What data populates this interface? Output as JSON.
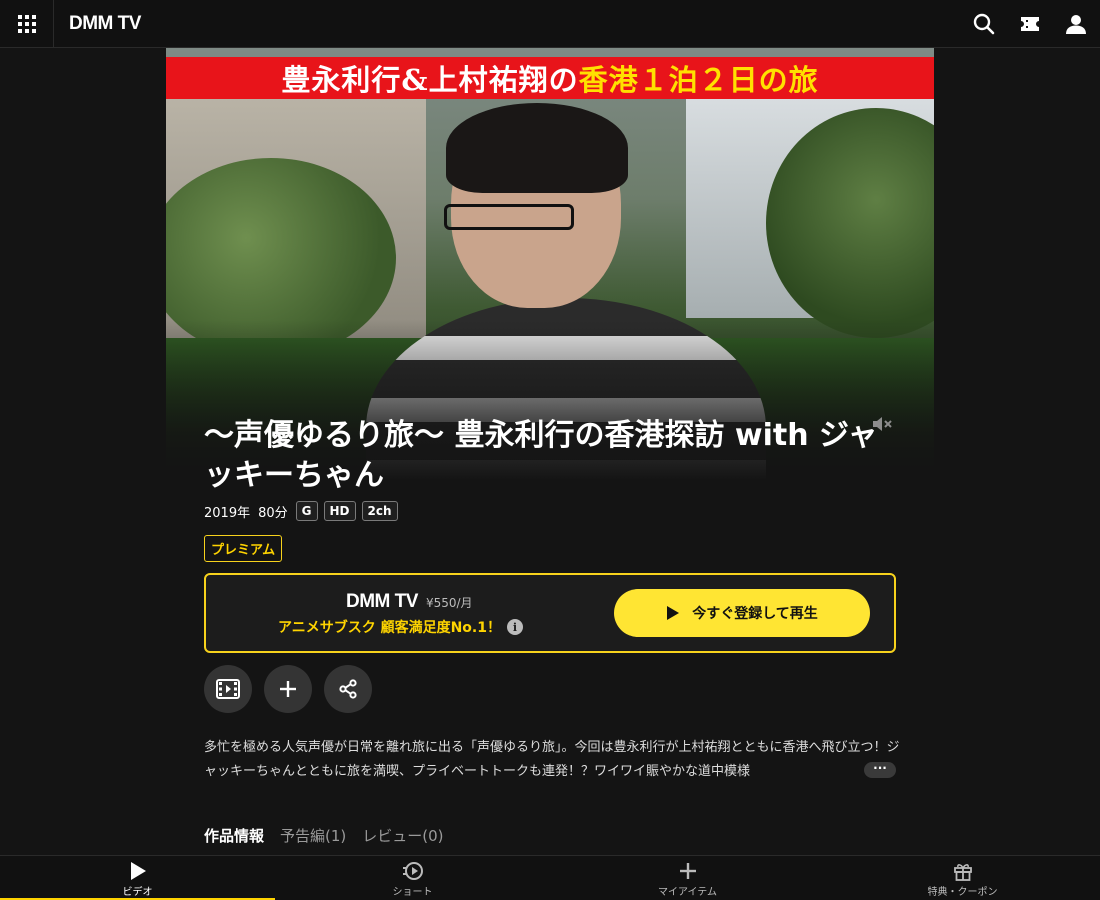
{
  "header": {
    "logo": "DMM TV",
    "icons": [
      "apps-grid-icon",
      "search-icon",
      "ticket-icon",
      "account-icon"
    ]
  },
  "hero": {
    "banner_main": "豊永利行&上村祐翔の",
    "banner_highlight": "香港１泊２日の旅",
    "banner_colors": {
      "background": "#e8141a",
      "text": "#ffffff",
      "highlight": "#ffe100"
    },
    "mute_icon": "speaker-muted-icon"
  },
  "title": "～声優ゆるり旅～ 豊永利行の香港探訪 with ジャッキーちゃん",
  "meta": {
    "year": "2019年",
    "duration": "80分",
    "rating": "G",
    "quality": "HD",
    "audio": "2ch"
  },
  "badge": "プレミアム",
  "subscribe": {
    "logo": "DMM TV",
    "price": "¥550/月",
    "tagline": "アニメサブスク 顧客満足度No.1！",
    "info_icon": "i",
    "play_label": "今すぐ登録して再生",
    "accent": "#f7d21c",
    "button_color": "#ffe533"
  },
  "actions": [
    "trailer-icon",
    "add-icon",
    "share-icon"
  ],
  "description": "多忙を極める人気声優が日常を離れ旅に出る「声優ゆるり旅」。今回は豊永利行が上村祐翔とともに香港へ飛び立つ！ジャッキーちゃんとともに旅を満喫、プライベートトークも連発！？ワイワイ賑やかな道中模様",
  "more_label": "···",
  "tabs": [
    {
      "label": "作品情報",
      "active": true
    },
    {
      "label": "予告編(1)",
      "active": false
    },
    {
      "label": "レビュー(0)",
      "active": false
    }
  ],
  "bottom_nav": [
    {
      "label": "ビデオ",
      "icon": "play-icon",
      "active": true
    },
    {
      "label": "ショート",
      "icon": "short-play-icon",
      "active": false
    },
    {
      "label": "マイアイテム",
      "icon": "plus-icon",
      "active": false
    },
    {
      "label": "特典・クーポン",
      "icon": "gift-icon",
      "active": false
    }
  ]
}
